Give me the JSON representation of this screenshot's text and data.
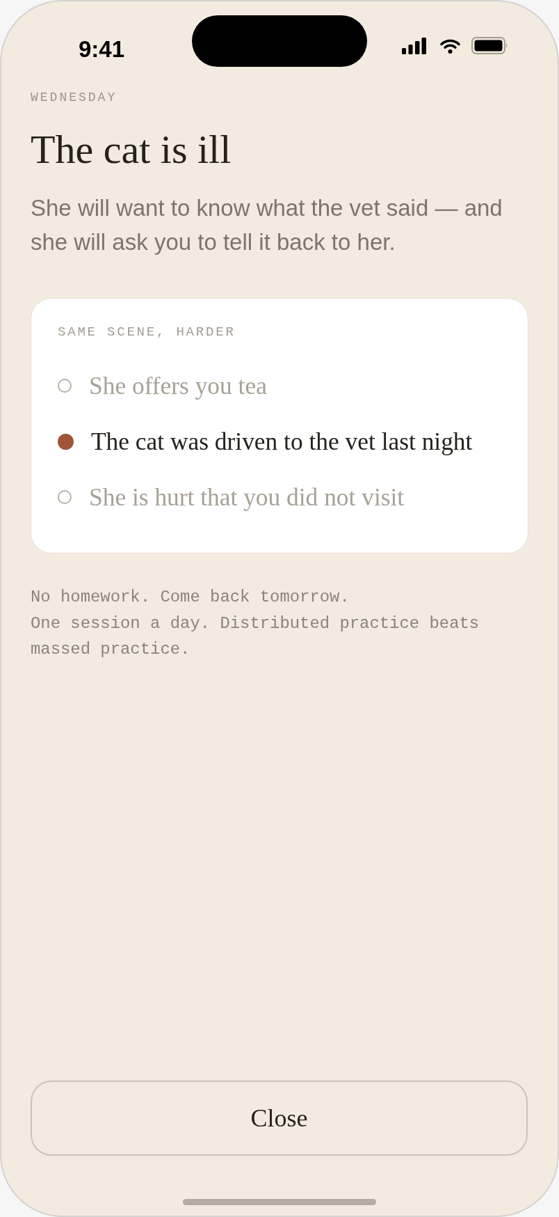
{
  "status_bar": {
    "time": "9:41"
  },
  "header": {
    "eyebrow": "WEDNESDAY",
    "title": "The cat is ill",
    "subtitle": "She will want to know what the vet said — and she will ask you to tell it back to her."
  },
  "card": {
    "label": "SAME SCENE, HARDER",
    "options": [
      {
        "text": "She offers you tea",
        "selected": false
      },
      {
        "text": "The cat was driven to the vet last night",
        "selected": true
      },
      {
        "text": "She is hurt that you did not visit",
        "selected": false
      }
    ]
  },
  "footer_lines": [
    "No homework. Come back tomorrow.",
    "One session a day. Distributed practice beats massed practice."
  ],
  "close_button": {
    "label": "Close"
  }
}
